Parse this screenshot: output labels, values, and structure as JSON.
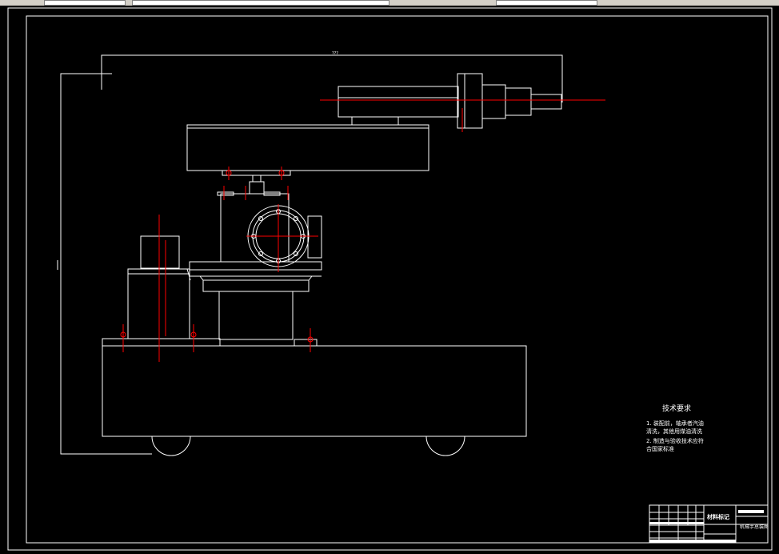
{
  "drawing": {
    "dimension_label": "???",
    "technical_requirements": {
      "heading": "技术要求",
      "items": [
        "1. 装配前，轴承者汽油",
        "清洗，其他用煤油清洗",
        "2. 制造与验收技术应符",
        "合国家标准"
      ]
    },
    "title_block": {
      "material_label": "材料标记",
      "drawing_name": "机械手总装图"
    }
  },
  "colors": {
    "background": "#000000",
    "line": "#ffffff",
    "centerline": "#ff0000",
    "toolbar": "#d4d0c8"
  }
}
